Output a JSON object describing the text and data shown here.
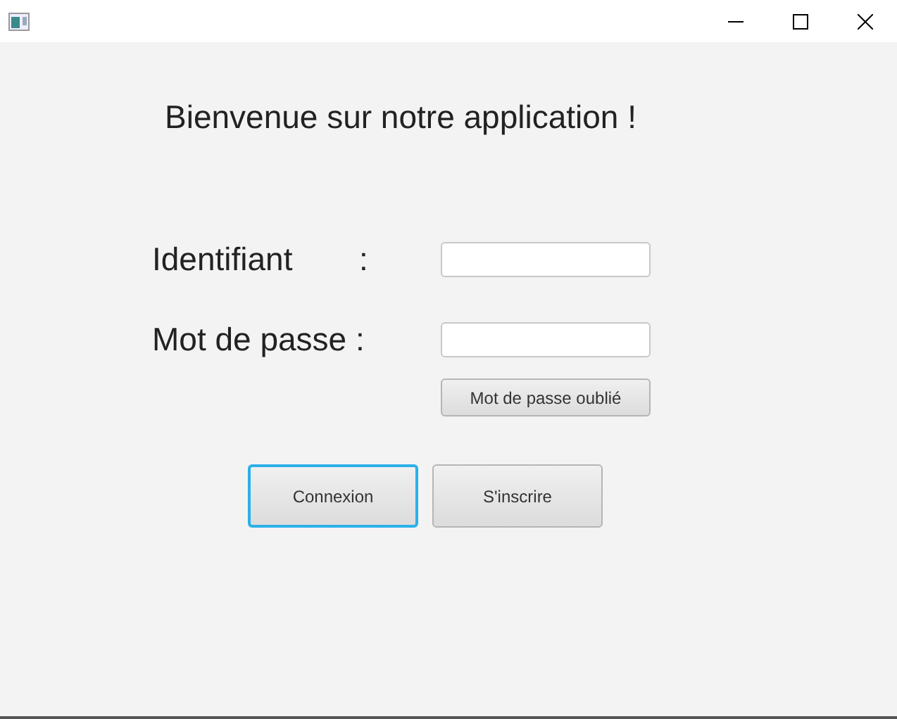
{
  "heading": "Bienvenue sur notre application !",
  "fields": [
    {
      "label": "Identifiant",
      "separator": ":"
    },
    {
      "label": "Mot de passe :"
    }
  ],
  "link_button": {
    "label": "Mot de passe oublié"
  },
  "buttons": [
    {
      "label": "Connexion",
      "focused": true
    },
    {
      "label": "S'inscrire",
      "focused": false
    }
  ]
}
